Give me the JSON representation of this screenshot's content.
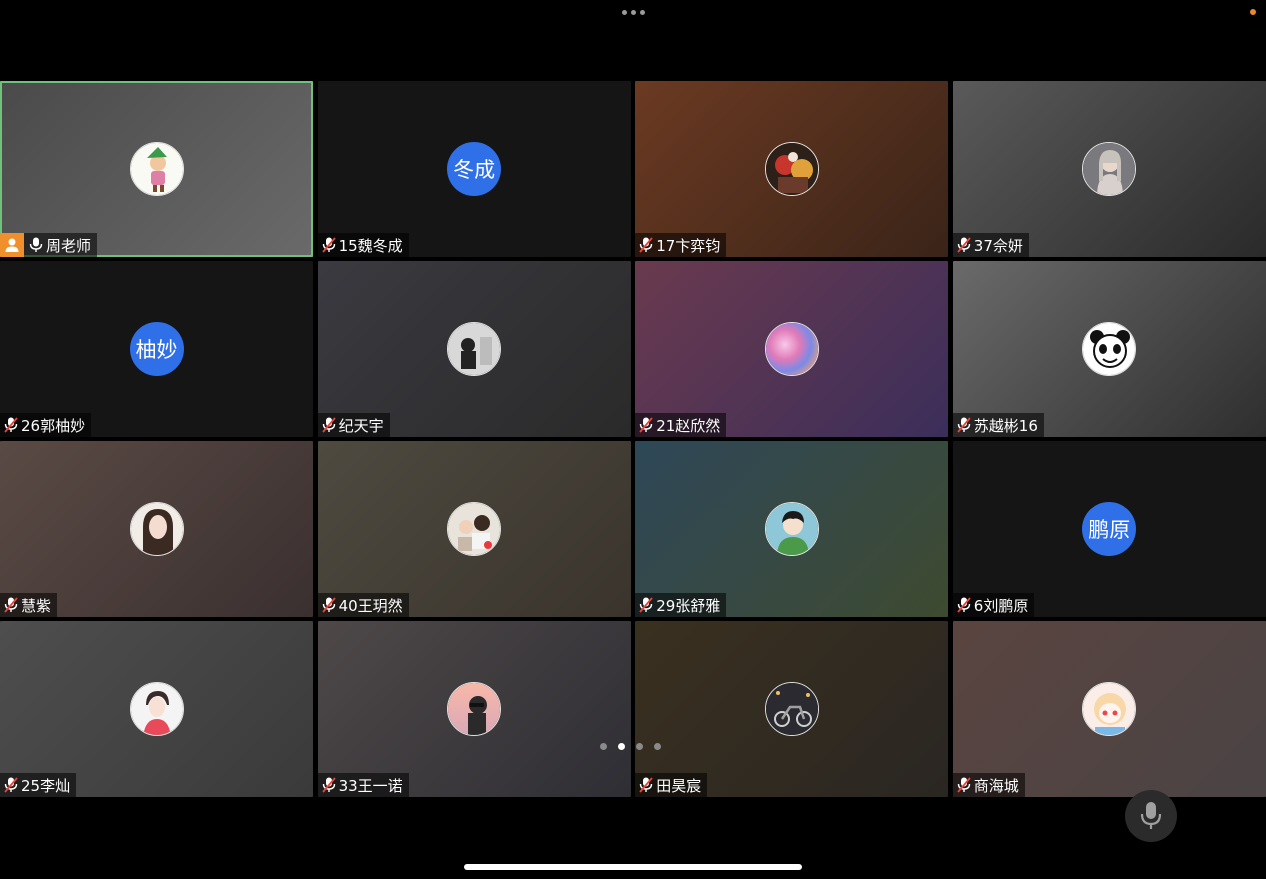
{
  "page_indicator": {
    "count": 4,
    "active": 1
  },
  "colors": {
    "text_avatar": "#2f6fe8",
    "active_border": "#6fc17c",
    "host_badge": "#f0902c",
    "status_dot": "#e8892c"
  },
  "participants": [
    {
      "name": "周老师",
      "host": true,
      "mic": "on",
      "active": true,
      "avatar": "cartoon-elf",
      "bg": [
        "#4a4a4a",
        "#6a6a6a"
      ]
    },
    {
      "name": "15魏冬成",
      "mic": "muted",
      "avatar_text": "冬成",
      "bg": [
        "#151515",
        "#151515"
      ]
    },
    {
      "name": "17卞弈钧",
      "mic": "muted",
      "avatar": "anime-warriors",
      "bg": [
        "#6b3a22",
        "#3a2418"
      ]
    },
    {
      "name": "37佘妍",
      "mic": "muted",
      "avatar": "girl-photo",
      "bg": [
        "#5a5a5a",
        "#2a2a2a"
      ]
    },
    {
      "name": "26郭柚妙",
      "mic": "muted",
      "avatar_text": "柚妙",
      "bg": [
        "#151515",
        "#151515"
      ]
    },
    {
      "name": "纪天宇",
      "mic": "muted",
      "avatar": "silhouette-photo",
      "bg": [
        "#3a3a40",
        "#2a2a2a"
      ]
    },
    {
      "name": "21赵欣然",
      "mic": "muted",
      "avatar": "galaxy",
      "bg": [
        "#6a3a4e",
        "#3b2e5a"
      ]
    },
    {
      "name": "苏越彬16",
      "mic": "muted",
      "avatar": "panda-meme",
      "bg": [
        "#6a6a6a",
        "#2e2e2e"
      ]
    },
    {
      "name": "慧紫",
      "mic": "muted",
      "avatar": "woman-photo",
      "bg": [
        "#5a4a44",
        "#3a3030"
      ]
    },
    {
      "name": "40王玥然",
      "mic": "muted",
      "avatar": "family-photo",
      "bg": [
        "#4e4a40",
        "#3a342c"
      ]
    },
    {
      "name": "29张舒雅",
      "mic": "muted",
      "avatar": "cartoon-boy",
      "bg": [
        "#2e4858",
        "#3e4a30"
      ]
    },
    {
      "name": "6刘鹏原",
      "mic": "muted",
      "avatar_text": "鹏原",
      "bg": [
        "#151515",
        "#151515"
      ]
    },
    {
      "name": "25李灿",
      "mic": "muted",
      "avatar": "anime-girl-red",
      "bg": [
        "#4e4e4e",
        "#3a3a3a"
      ]
    },
    {
      "name": "33王一诺",
      "mic": "muted",
      "avatar": "sunset-photo",
      "bg": [
        "#4e4848",
        "#2e2e34"
      ]
    },
    {
      "name": "田昊宸",
      "mic": "muted",
      "avatar": "motorcycle-photo",
      "bg": [
        "#3a3020",
        "#2a2622"
      ]
    },
    {
      "name": "商海城",
      "mic": "muted",
      "avatar": "anime-girl-chibi",
      "bg": [
        "#5a4440",
        "#4a4444"
      ]
    }
  ]
}
